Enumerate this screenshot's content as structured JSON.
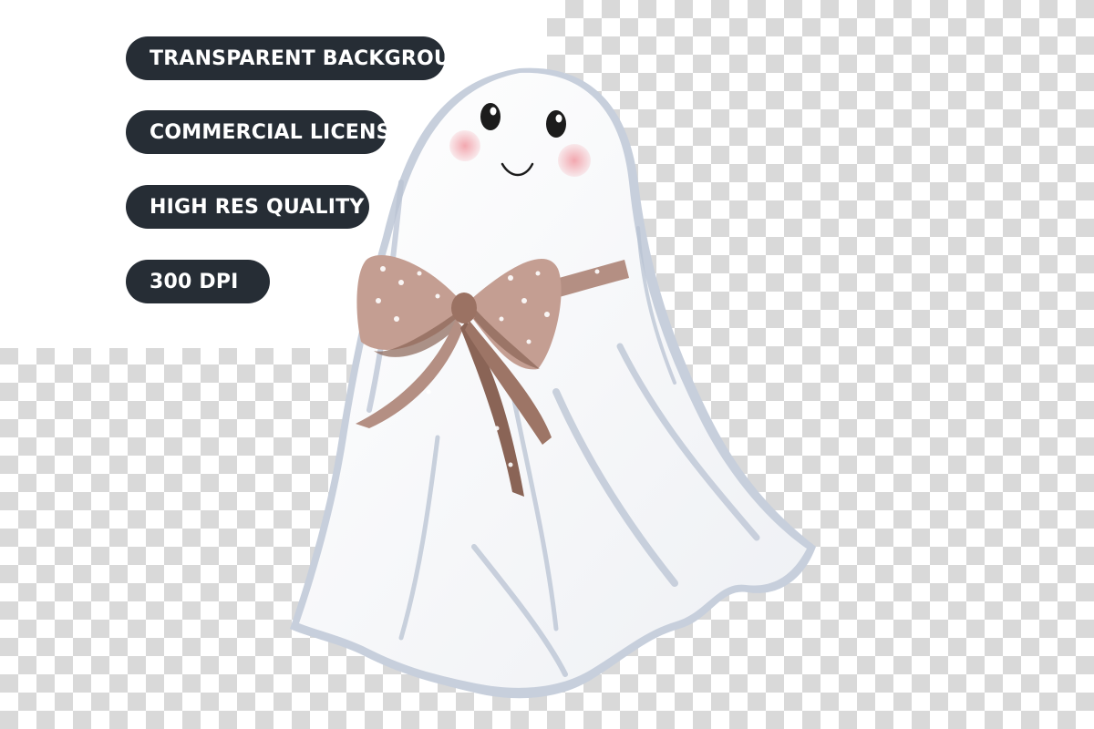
{
  "badges": [
    {
      "label": "TRANSPARENT BACKGROUND"
    },
    {
      "label": "COMMERCIAL LICENSE"
    },
    {
      "label": "HIGH RES QUALITY"
    },
    {
      "label": "300 DPI"
    }
  ],
  "illustration": {
    "subject": "ghost-icon",
    "accessory": "bow-icon",
    "colors": {
      "sheet": "#f7f6f3",
      "shadow": "#b9c3d3",
      "bow": "#b48f83",
      "bow_dark": "#7b5648",
      "cheek": "#f2a3ab",
      "badge_bg": "#262d35"
    }
  }
}
